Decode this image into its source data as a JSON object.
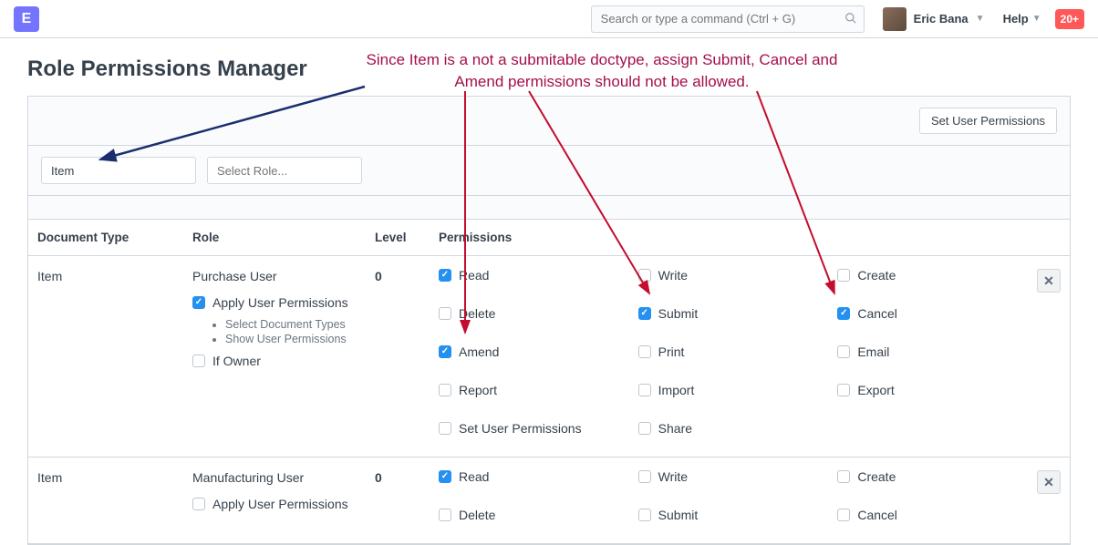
{
  "navbar": {
    "logo_letter": "E",
    "search_placeholder": "Search or type a command (Ctrl + G)",
    "user_name": "Eric Bana",
    "help_label": "Help",
    "badge": "20+"
  },
  "page": {
    "title": "Role Permissions Manager"
  },
  "annotation": {
    "text": "Since Item is a not a submitable doctype, assign Submit, Cancel and Amend permissions should not be allowed."
  },
  "toolbar": {
    "set_user_perms": "Set User Permissions",
    "doctype_value": "Item",
    "role_placeholder": "Select Role..."
  },
  "table": {
    "headers": {
      "doctype": "Document Type",
      "role": "Role",
      "level": "Level",
      "permissions": "Permissions"
    },
    "rows": [
      {
        "doctype": "Item",
        "role": "Purchase User",
        "apply_user_perms": {
          "label": "Apply User Permissions",
          "checked": true
        },
        "sub_items": [
          "Select Document Types",
          "Show User Permissions"
        ],
        "if_owner": {
          "label": "If Owner",
          "checked": false
        },
        "level": "0",
        "perms": [
          {
            "label": "Read",
            "checked": true
          },
          {
            "label": "Write",
            "checked": false
          },
          {
            "label": "Create",
            "checked": false
          },
          {
            "label": "Delete",
            "checked": false
          },
          {
            "label": "Submit",
            "checked": true
          },
          {
            "label": "Cancel",
            "checked": true
          },
          {
            "label": "Amend",
            "checked": true
          },
          {
            "label": "Print",
            "checked": false
          },
          {
            "label": "Email",
            "checked": false
          },
          {
            "label": "Report",
            "checked": false
          },
          {
            "label": "Import",
            "checked": false
          },
          {
            "label": "Export",
            "checked": false
          },
          {
            "label": "Set User Permissions",
            "checked": false
          },
          {
            "label": "Share",
            "checked": false
          }
        ]
      },
      {
        "doctype": "Item",
        "role": "Manufacturing User",
        "apply_user_perms": {
          "label": "Apply User Permissions",
          "checked": false
        },
        "sub_items": [],
        "if_owner": null,
        "level": "0",
        "perms": [
          {
            "label": "Read",
            "checked": true
          },
          {
            "label": "Write",
            "checked": false
          },
          {
            "label": "Create",
            "checked": false
          },
          {
            "label": "Delete",
            "checked": false
          },
          {
            "label": "Submit",
            "checked": false
          },
          {
            "label": "Cancel",
            "checked": false
          }
        ]
      }
    ]
  }
}
